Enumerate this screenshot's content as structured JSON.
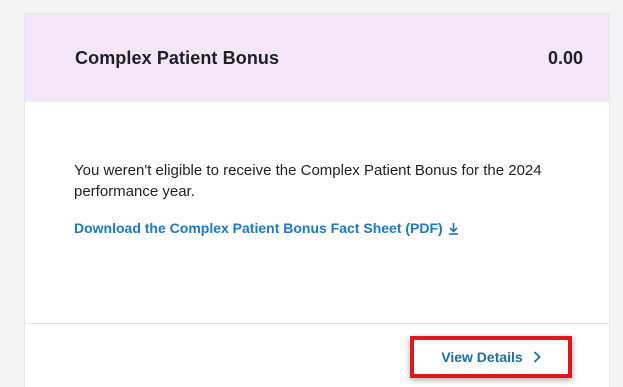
{
  "card": {
    "title": "Complex Patient Bonus",
    "amount": "0.00",
    "message": "You weren't eligible to receive the Complex Patient Bonus for the 2024 performance year.",
    "fact_sheet_link": "Download the Complex Patient Bonus Fact Sheet (PDF)",
    "view_details_label": "View Details"
  },
  "icons": {
    "download": "download-arrow-icon",
    "chevron": "chevron-right-icon"
  },
  "colors": {
    "header_bg": "#f3e6f6",
    "link": "#1b79c8",
    "highlight_border": "#e4141b"
  }
}
